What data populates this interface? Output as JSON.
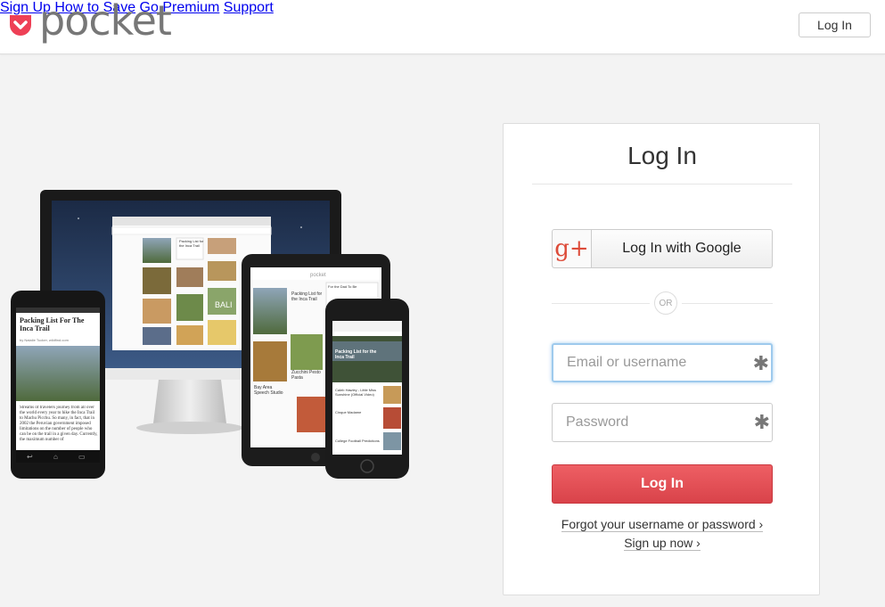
{
  "brand": {
    "name": "pocket",
    "color": "#ee4056"
  },
  "nav": {
    "sign_up": "Sign Up",
    "how_to_save": "How to Save",
    "go_premium": "Go Premium",
    "support": "Support",
    "log_in": "Log In"
  },
  "devices": {
    "phone_article_title": "Packing List For The Inca Trail",
    "phone_article_byline": "by Natalie Tucker, wildfind.com",
    "phone_article_body": "Streams of travelers journey from all over the world every year to hike the Inca Trail to Machu Picchu. So many, in fact, that in 2002 the Peruvian government imposed limitations on the number of people who can be on the trail in a given day. Currently, the maximum number of",
    "tablet_brand": "pocket",
    "tablet_items": [
      "Packing List for the Inca Trail",
      "For the Dad To Be",
      "Zucchini Pesto Pasta",
      "Bay Area Speech Studio",
      "Our Summer A",
      "Packing List: Inc"
    ],
    "iphone_brand": "pocket",
    "iphone_items": [
      "Packing List for the Inca Trail",
      "Caleb Hawley - Little Miss Sunshine (Official Video)",
      "Cinque Madame",
      "College Football Predictions"
    ],
    "monitor_tiles": [
      "Packing List for the Inca Trail",
      "BALI"
    ]
  },
  "login": {
    "title": "Log In",
    "google_label": "Log In with Google",
    "google_icon": "g+",
    "or": "OR",
    "email_placeholder": "Email or username",
    "password_placeholder": "Password",
    "required_mark": "✱",
    "submit": "Log In",
    "forgot": "Forgot your username or password ›",
    "signup": "Sign up now ›",
    "accent": "#e5525a"
  }
}
